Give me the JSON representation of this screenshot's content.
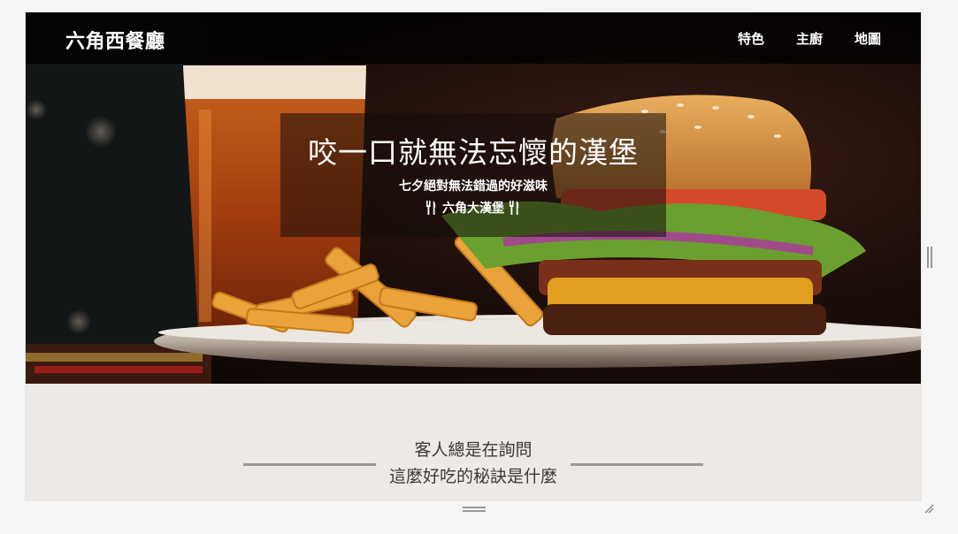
{
  "navbar": {
    "brand": "六角西餐廳",
    "links": [
      {
        "label": "特色"
      },
      {
        "label": "主廚"
      },
      {
        "label": "地圖"
      }
    ]
  },
  "hero": {
    "title": "咬一口就無法忘懷的漢堡",
    "subtitle": "七夕絕對無法錯過的好滋味",
    "tag_text": "六角大漢堡",
    "tag_icon": "cutlery-icon"
  },
  "section": {
    "heading_line1": "客人總是在詢問",
    "heading_line2": "這麼好吃的秘訣是什麼"
  },
  "colors": {
    "navbar_bg": "#000000",
    "section_bg": "#ede9e7",
    "rule": "#9a9a9a"
  }
}
